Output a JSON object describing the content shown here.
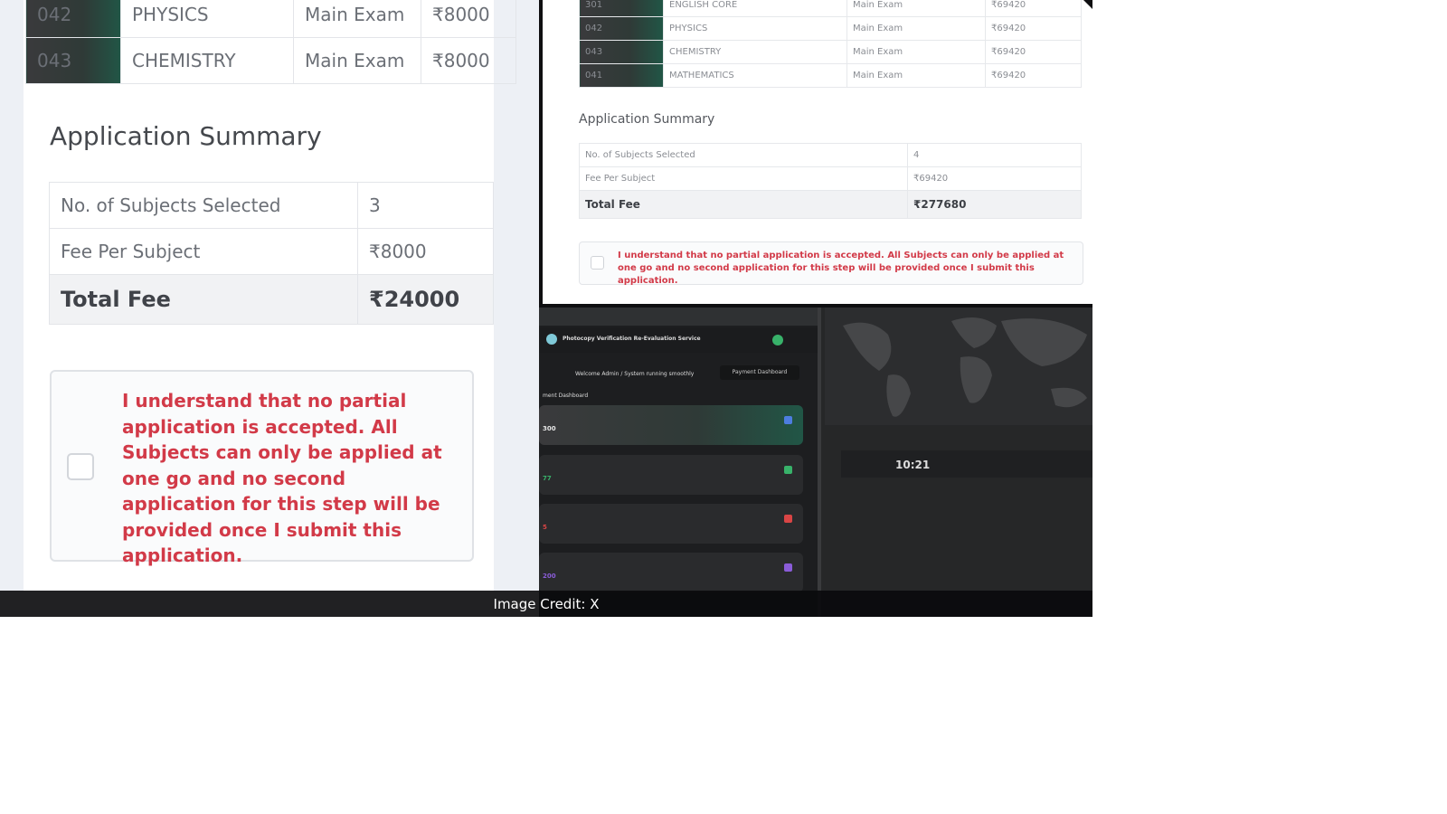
{
  "left_panel": {
    "subjects": [
      {
        "code": "042",
        "name": "PHYSICS",
        "type": "Main Exam",
        "fee": "₹8000"
      },
      {
        "code": "043",
        "name": "CHEMISTRY",
        "type": "Main Exam",
        "fee": "₹8000"
      }
    ],
    "summary_heading": "Application Summary",
    "summary": {
      "subjects_selected_label": "No. of Subjects Selected",
      "subjects_selected_value": "3",
      "fee_per_subject_label": "Fee Per Subject",
      "fee_per_subject_value": "₹8000",
      "total_label": "Total Fee",
      "total_value": "₹24000"
    },
    "acknowledgement": "I understand that no partial application is accepted. All Subjects can only be applied at one go and no second application for this step will be provided once I submit this application."
  },
  "right_panel": {
    "subjects": [
      {
        "code": "301",
        "name": "ENGLISH CORE",
        "type": "Main Exam",
        "fee": "₹69420"
      },
      {
        "code": "042",
        "name": "PHYSICS",
        "type": "Main Exam",
        "fee": "₹69420"
      },
      {
        "code": "043",
        "name": "CHEMISTRY",
        "type": "Main Exam",
        "fee": "₹69420"
      },
      {
        "code": "041",
        "name": "MATHEMATICS",
        "type": "Main Exam",
        "fee": "₹69420"
      }
    ],
    "summary_heading": "Application Summary",
    "summary": {
      "subjects_selected_label": "No. of Subjects Selected",
      "subjects_selected_value": "4",
      "fee_per_subject_label": "Fee Per Subject",
      "fee_per_subject_value": "₹69420",
      "total_label": "Total Fee",
      "total_value": "₹277680"
    },
    "acknowledgement": "I understand that no partial application is accepted. All Subjects can only be applied at one go and no second application for this step will be provided once I submit this application."
  },
  "dashboard": {
    "app_title": "Photocopy Verification Re-Evaluation Service",
    "welcome_text": "Welcome Admin / System running smoothly",
    "dashboard_button": "Payment Dashboard",
    "section_label": "ment Dashboard",
    "card_values": [
      "300",
      "77",
      "5",
      "200"
    ],
    "card_colors": [
      "#4d7de0",
      "#38b26a",
      "#d94545",
      "#8a5cd8"
    ],
    "clock": "10:21"
  },
  "caption": "Image Credit: X"
}
